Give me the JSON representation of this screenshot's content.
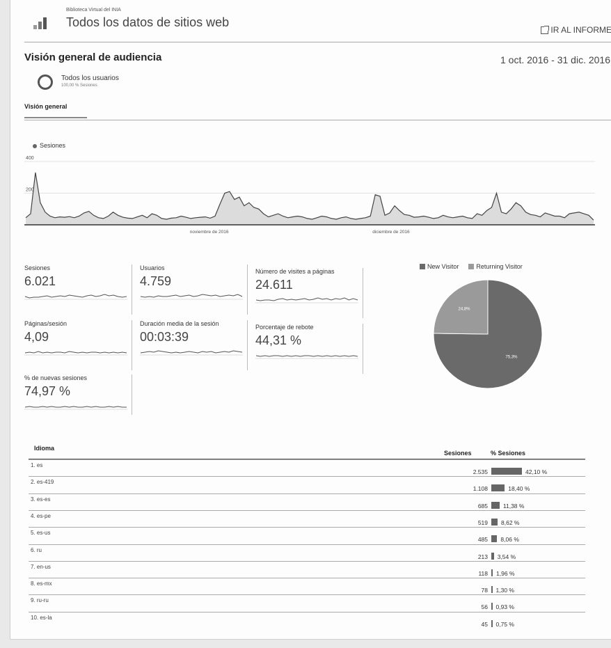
{
  "header": {
    "property_name": "Biblioteca Virtual del INIA",
    "title": "Todos los datos de sitios web",
    "go_report_label": "IR AL INFORME"
  },
  "overview": {
    "title": "Visión general de audiencia",
    "date_range": "1 oct. 2016 - 31 dic. 2016",
    "segment_name": "Todos los usuarios",
    "segment_sub": "100,00 % Sesiones",
    "tab_label": "Visión general"
  },
  "chart_data": {
    "type": "area",
    "series": [
      {
        "name": "Sesiones",
        "values": [
          45,
          70,
          330,
          140,
          80,
          55,
          45,
          50,
          48,
          52,
          45,
          55,
          75,
          85,
          60,
          45,
          40,
          55,
          80,
          60,
          48,
          42,
          40,
          50,
          60,
          45,
          70,
          60,
          40,
          35,
          42,
          45,
          55,
          48,
          40,
          45,
          48,
          50,
          42,
          55,
          130,
          200,
          210,
          160,
          175,
          120,
          140,
          110,
          100,
          70,
          50,
          60,
          70,
          55,
          45,
          50,
          55,
          50,
          40,
          35,
          45,
          55,
          50,
          40,
          35,
          45,
          50,
          40,
          35,
          40,
          45,
          55,
          190,
          180,
          60,
          75,
          120,
          90,
          65,
          60,
          48,
          50,
          55,
          48,
          40,
          45,
          60,
          50,
          45,
          50,
          55,
          45,
          40,
          70,
          60,
          90,
          110,
          200,
          80,
          70,
          100,
          140,
          120,
          80,
          65,
          60,
          50,
          75,
          65,
          55,
          55,
          45,
          70,
          75,
          80,
          70,
          60,
          30
        ]
      }
    ],
    "ylabels": [
      "400",
      "200"
    ],
    "ylim": [
      0,
      400
    ],
    "xlabels": [
      "noviembre de 2016",
      "diciembre de 2016"
    ],
    "grid": true
  },
  "metrics": [
    {
      "label": "Sesiones",
      "value": "6.021"
    },
    {
      "label": "Usuarios",
      "value": "4.759"
    },
    {
      "label": "Número de visites a páginas",
      "value": "24.611"
    },
    {
      "label": "Páginas/sesión",
      "value": "4,09"
    },
    {
      "label": "Duración media de la sesión",
      "value": "00:03:39"
    },
    {
      "label": "Porcentaje de rebote",
      "value": "44,31 %"
    },
    {
      "label": "% de nuevas sesiones",
      "value": "74,97 %"
    }
  ],
  "pie": {
    "legend": [
      {
        "label": "New Visitor",
        "color": "#6a6a6a"
      },
      {
        "label": "Returning Visitor",
        "color": "#9a9a9a"
      }
    ],
    "slices": [
      {
        "label": "75,3%",
        "value": 75.3,
        "color": "#6a6a6a"
      },
      {
        "label": "24,8%",
        "value": 24.8,
        "color": "#9a9a9a"
      }
    ]
  },
  "table": {
    "header_idioma": "Idioma",
    "header_sesiones": "Sesiones",
    "header_pct": "% Sesiones",
    "rows": [
      {
        "lang": "1. es",
        "sessions": "2.535",
        "pct": "42,10 %",
        "share": 42.1
      },
      {
        "lang": "2. es-419",
        "sessions": "1.108",
        "pct": "18,40 %",
        "share": 18.4
      },
      {
        "lang": "3. es-es",
        "sessions": "685",
        "pct": "11,38 %",
        "share": 11.38
      },
      {
        "lang": "4. es-pe",
        "sessions": "519",
        "pct": "8,62 %",
        "share": 8.62
      },
      {
        "lang": "5. es-us",
        "sessions": "485",
        "pct": "8,06 %",
        "share": 8.06
      },
      {
        "lang": "6. ru",
        "sessions": "213",
        "pct": "3,54 %",
        "share": 3.54
      },
      {
        "lang": "7. en-us",
        "sessions": "118",
        "pct": "1,96 %",
        "share": 1.96
      },
      {
        "lang": "8. es-mx",
        "sessions": "78",
        "pct": "1,30 %",
        "share": 1.3
      },
      {
        "lang": "9. ru-ru",
        "sessions": "56",
        "pct": "0,93 %",
        "share": 0.93
      },
      {
        "lang": "10. es-la",
        "sessions": "45",
        "pct": "0,75 %",
        "share": 0.75
      }
    ]
  }
}
